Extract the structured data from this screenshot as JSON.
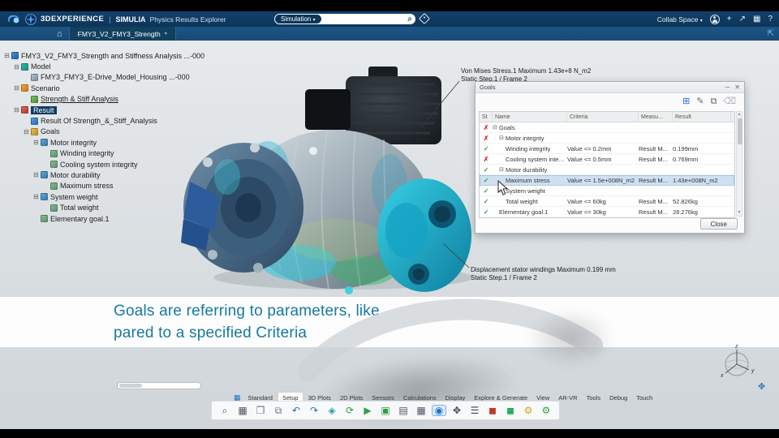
{
  "topbar": {
    "brand": "3DEXPERIENCE",
    "divider": "|",
    "suite": "SIMULIA",
    "app_name": "Physics Results Explorer",
    "search": {
      "scope": "Simulation",
      "caret": "▾"
    },
    "collab": {
      "label": "Collab Space",
      "caret": "▾"
    }
  },
  "icons": {
    "search": "⌕",
    "home": "⌂",
    "fullscreen": "⇱",
    "add": "+",
    "share": "↗",
    "apps": "▦",
    "help": "?",
    "minimize": "─",
    "close": "✕",
    "workbench": "▦",
    "pan": "✥"
  },
  "tabbar": {
    "tab_label": "FMY3_V2_FMY3_Strength",
    "tab_caret": "▾"
  },
  "tree": {
    "items": [
      {
        "label": "FMY3_V2_FMY3_Strength and Stiffness Analysis ...-000",
        "level": 0,
        "toggle": "minus",
        "icon": "analysis"
      },
      {
        "label": "Model",
        "level": 1,
        "toggle": "minus",
        "icon": "model"
      },
      {
        "label": "FMY3_FMY3_E-Drive_Model_Housing ...-000",
        "level": 2,
        "toggle": "none",
        "icon": "part"
      },
      {
        "label": "Scenario",
        "level": 1,
        "toggle": "minus",
        "icon": "scenario"
      },
      {
        "label": "Strength & Stiff Analysis",
        "level": 2,
        "toggle": "none",
        "icon": "case",
        "underline": true
      },
      {
        "label": "Result",
        "level": 1,
        "toggle": "minus",
        "icon": "result",
        "selected": true
      },
      {
        "label": "Result Of Strength_&_Stiff_Analysis",
        "level": 2,
        "toggle": "none",
        "icon": "resultitem"
      },
      {
        "label": "Goals",
        "level": 2,
        "toggle": "minus",
        "icon": "goals"
      },
      {
        "label": "Motor integrity",
        "level": 3,
        "toggle": "minus",
        "icon": "goalgroup"
      },
      {
        "label": "Winding integrity",
        "level": 4,
        "toggle": "none",
        "icon": "goal"
      },
      {
        "label": "Cooling system integrity",
        "level": 4,
        "toggle": "none",
        "icon": "goal"
      },
      {
        "label": "Motor durability",
        "level": 3,
        "toggle": "minus",
        "icon": "goalgroup"
      },
      {
        "label": "Maximum stress",
        "level": 4,
        "toggle": "none",
        "icon": "goal"
      },
      {
        "label": "System weight",
        "level": 3,
        "toggle": "minus",
        "icon": "goalgroup"
      },
      {
        "label": "Total weight",
        "level": 4,
        "toggle": "none",
        "icon": "goal"
      },
      {
        "label": "Elementary goal.1",
        "level": 3,
        "toggle": "none",
        "icon": "goal"
      }
    ]
  },
  "viewport": {
    "annotation_top": {
      "line1": "Von Mises Stress.1 Maximum 1.43e+8 N_m2",
      "line2": "Static Step.1 / Frame 2"
    },
    "annotation_bottom": {
      "line1": "Displacement stator windings Maximum 0.199 mm",
      "line2": "Static Step.1 / Frame 2"
    },
    "compass_axes": {
      "x": "x",
      "y": "y",
      "z": "z"
    }
  },
  "goals_panel": {
    "title": "Goals",
    "titlebar_icons": [
      {
        "name": "panel-minimize-icon",
        "glyph": "─"
      },
      {
        "name": "panel-close-icon",
        "glyph": "✕"
      }
    ],
    "toolbar_icons": [
      {
        "name": "add-goal-icon",
        "glyph": "⊞",
        "color": "#1d6fd1"
      },
      {
        "name": "edit-goal-icon",
        "glyph": "✎",
        "color": "#5a6470"
      },
      {
        "name": "duplicate-goal-icon",
        "glyph": "⧉",
        "color": "#5a6470"
      },
      {
        "name": "delete-goal-icon",
        "glyph": "⌫",
        "color": "#aab2ba"
      }
    ],
    "columns": {
      "st": "St",
      "name": "Name",
      "criteria": "Criteria",
      "measure": "Measu...",
      "result": "Result"
    },
    "rows": [
      {
        "status": "fail",
        "name": "Goals",
        "level": 0,
        "group": true,
        "criteria": "",
        "measure": "",
        "result": ""
      },
      {
        "status": "fail",
        "name": "Motor integrity",
        "level": 1,
        "group": true,
        "criteria": "",
        "measure": "",
        "result": ""
      },
      {
        "status": "pass",
        "name": "Winding integrity",
        "level": 2,
        "criteria": "Value <= 0.2mm",
        "measure": "Result M...",
        "result": "0.199mm"
      },
      {
        "status": "fail",
        "name": "Cooling system integrity",
        "level": 2,
        "criteria": "Value <= 0.5mm",
        "measure": "Result M...",
        "result": "0.769mm"
      },
      {
        "status": "pass",
        "name": "Motor durability",
        "level": 1,
        "group": true,
        "criteria": "",
        "measure": "",
        "result": ""
      },
      {
        "status": "pass",
        "name": "Maximum stress",
        "level": 2,
        "selected": true,
        "criteria": "Value <= 1.5e+008N_m2",
        "measure": "Result M...",
        "result": "1.43e+008N_m2"
      },
      {
        "status": "pass",
        "name": "System weight",
        "level": 1,
        "group": true,
        "criteria": "",
        "measure": "",
        "result": ""
      },
      {
        "status": "pass",
        "name": "Total weight",
        "level": 2,
        "criteria": "Value <= 60kg",
        "measure": "Result M...",
        "result": "52.826kg"
      },
      {
        "status": "pass",
        "name": "Elementary goal.1",
        "level": 1,
        "criteria": "Value <= 30kg",
        "measure": "Result M...",
        "result": "28.276kg"
      }
    ],
    "close_label": "Close"
  },
  "caption": {
    "line1": "Goals are referring to parameters, like",
    "line2": "pared to a specified Criteria"
  },
  "ribbon": {
    "tabs": [
      {
        "label": "Standard"
      },
      {
        "label": "Setup",
        "active": true
      },
      {
        "label": "3D Plots"
      },
      {
        "label": "2D Plots"
      },
      {
        "label": "Sensors"
      },
      {
        "label": "Calculations"
      },
      {
        "label": "Display"
      },
      {
        "label": "Explore & Generate"
      },
      {
        "label": "View"
      },
      {
        "label": "AR-VR"
      },
      {
        "label": "Tools"
      },
      {
        "label": "Debug"
      },
      {
        "label": "Touch"
      }
    ]
  },
  "toolbar": {
    "icons": [
      {
        "name": "zoom-icon",
        "glyph": "⌕",
        "color": "#4a5560"
      },
      {
        "name": "view-box-icon",
        "glyph": "▦",
        "color": "#4a5560"
      },
      {
        "name": "paste-icon",
        "glyph": "❐",
        "color": "#6b7685"
      },
      {
        "name": "copy-icon",
        "glyph": "⧉",
        "color": "#6b7685"
      },
      {
        "name": "undo-icon",
        "glyph": "↶",
        "color": "#2a72b8"
      },
      {
        "name": "redo-icon",
        "glyph": "↷",
        "color": "#2a72b8"
      },
      {
        "name": "compare-icon",
        "glyph": "◈",
        "color": "#2aa1a8"
      },
      {
        "name": "update-icon",
        "glyph": "⟳",
        "color": "#2f9e44"
      },
      {
        "name": "play-results-icon",
        "glyph": "▶",
        "color": "#2f9e44"
      },
      {
        "name": "export-display-icon",
        "glyph": "▣",
        "color": "#2f9e44"
      },
      {
        "name": "report-icon",
        "glyph": "▤",
        "color": "#4a5560"
      },
      {
        "name": "table-icon",
        "glyph": "▦",
        "color": "#4a5560"
      },
      {
        "name": "sensor-probe-icon",
        "glyph": "◉",
        "color": "#1d6fd1",
        "active": true
      },
      {
        "name": "transform-icon",
        "glyph": "✥",
        "color": "#3a4450"
      },
      {
        "name": "list-icon",
        "glyph": "☰",
        "color": "#3a4450"
      },
      {
        "name": "mesh-red-icon",
        "glyph": "◼",
        "color": "#c0392b"
      },
      {
        "name": "mesh-green-icon",
        "glyph": "◼",
        "color": "#27ae60"
      },
      {
        "name": "gear-yellow-icon",
        "glyph": "⚙",
        "color": "#d4a017"
      },
      {
        "name": "gear-green-icon",
        "glyph": "⚙",
        "color": "#2f9e44"
      }
    ]
  },
  "colors": {
    "topbar_navy": "#0d3559",
    "accent_blue": "#1d6fd1",
    "pass_green": "#2e9e44",
    "fail_red": "#d32f2f",
    "caption_teal": "#1678a3"
  }
}
